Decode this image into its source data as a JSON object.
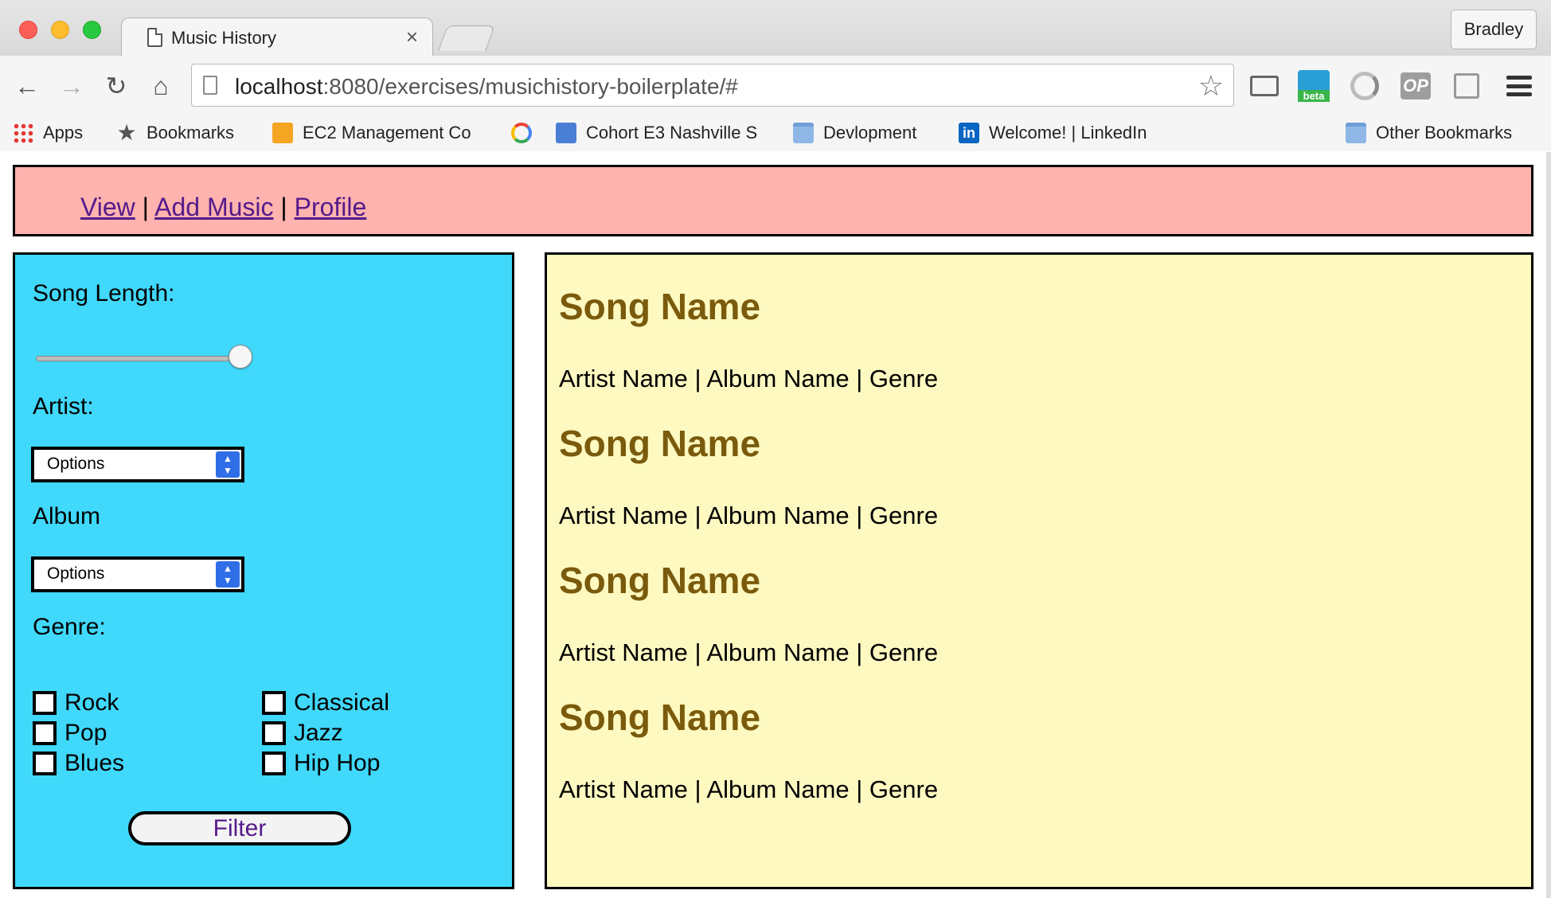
{
  "browser": {
    "tab_title": "Music History",
    "tab_close": "×",
    "profile_name": "Bradley",
    "url_host": "localhost",
    "url_rest": ":8080/exercises/musichistory-boilerplate/#",
    "nav": {
      "back": "←",
      "forward": "→",
      "reload": "↻",
      "home": "⌂",
      "bookmark_star": "☆"
    },
    "extensions": {
      "op_label": "OP"
    },
    "bookmarks": [
      {
        "label": "Apps",
        "icon": "apps-icon"
      },
      {
        "label": "Bookmarks",
        "icon": "star-icon"
      },
      {
        "label": "EC2 Management Co",
        "icon": "aws-box-icon"
      },
      {
        "label": "",
        "icon": "google-icon"
      },
      {
        "label": "Cohort E3 Nashville S",
        "icon": "blue-page-icon"
      },
      {
        "label": "Devlopment",
        "icon": "folder-icon"
      },
      {
        "label": "Welcome! | LinkedIn",
        "icon": "linkedin-icon"
      },
      {
        "label": "Other Bookmarks",
        "icon": "folder-icon"
      }
    ]
  },
  "nav_links": {
    "view": "View",
    "sep1": "|",
    "add_music": "Add Music",
    "sep2": "|",
    "profile": "Profile"
  },
  "sidebar": {
    "song_length_label": "Song Length:",
    "song_length_value": 1.0,
    "artist_label": "Artist:",
    "artist_select": "Options",
    "album_label": "Album",
    "album_select": "Options",
    "genre_label": "Genre:",
    "genres": [
      "Rock",
      "Classical",
      "Pop",
      "Jazz",
      "Blues",
      "Hip Hop"
    ],
    "filter_button": "Filter"
  },
  "songs": [
    {
      "name": "Song Name",
      "meta": "Artist Name | Album Name | Genre"
    },
    {
      "name": "Song Name",
      "meta": "Artist Name | Album Name | Genre"
    },
    {
      "name": "Song Name",
      "meta": "Artist Name | Album Name | Genre"
    },
    {
      "name": "Song Name",
      "meta": "Artist Name | Album Name | Genre"
    }
  ],
  "colors": {
    "header_bg": "#ffb3ae",
    "sidebar_bg": "#40d8fb",
    "content_bg": "#fef9c0",
    "song_name": "#7a5a0c",
    "link": "#551a8b"
  }
}
